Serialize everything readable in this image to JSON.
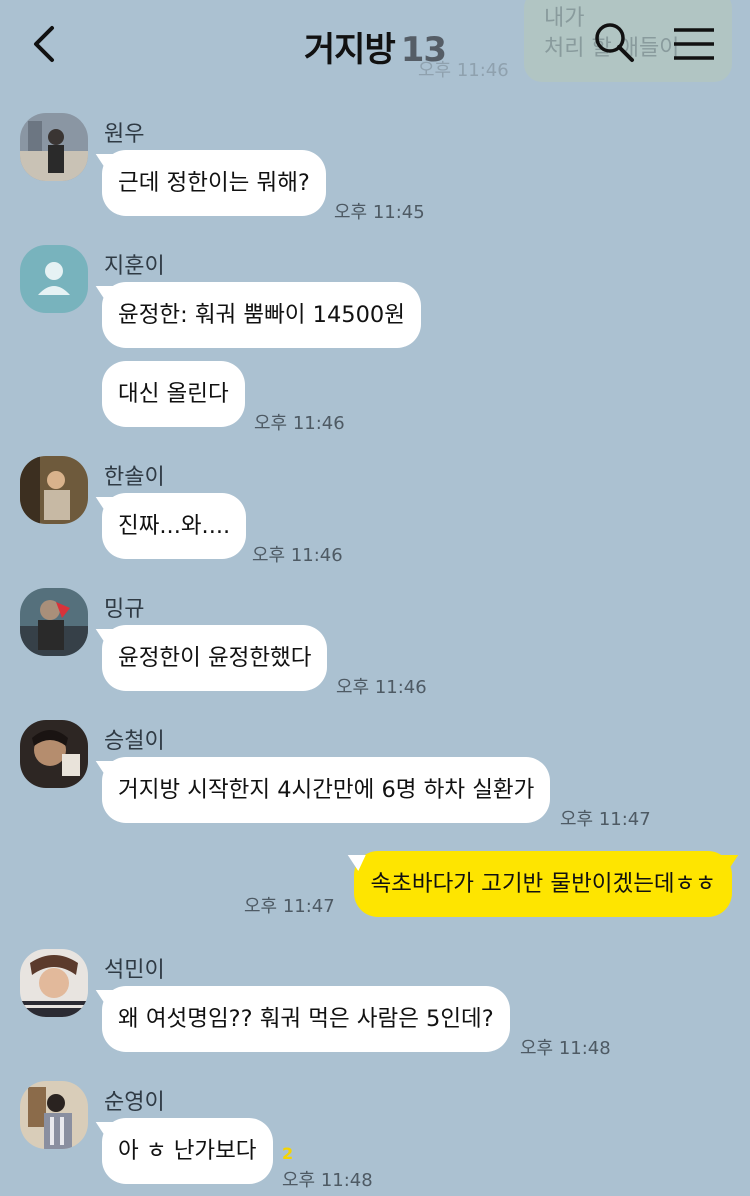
{
  "header": {
    "title": "거지방",
    "member_count": "13",
    "icons": [
      "chevron-left-icon",
      "search-icon",
      "hamburger-menu-icon"
    ]
  },
  "ghost_message": {
    "line1": "내가",
    "line2": "처리 할 애들이",
    "time": "오후 11:46"
  },
  "messages": [
    {
      "sender": "원우",
      "text": "근데 정한이는 뭐해?",
      "time": "오후 11:45"
    },
    {
      "sender": "지훈이",
      "text": "윤정한: 훠궈 뿜빠이 14500원"
    },
    {
      "text": "대신 올린다",
      "time": "오후 11:46"
    },
    {
      "sender": "한솔이",
      "text": "진짜...와....",
      "time": "오후 11:46"
    },
    {
      "sender": "밍규",
      "text": "윤정한이 윤정한했다",
      "time": "오후 11:46"
    },
    {
      "sender": "승철이",
      "text": "거지방 시작한지 4시간만에 6명 하차 실환가",
      "time": "오후 11:47"
    },
    {
      "sender": "me",
      "text": "속초바다가 고기반 물반이겠는데ㅎㅎ",
      "time": "오후 11:47"
    },
    {
      "sender": "석민이",
      "text": "왜 여섯명임?? 훠궈 먹은 사람은 5인데?",
      "time": "오후 11:48"
    },
    {
      "sender": "순영이",
      "text": "아 ㅎ 난가보다",
      "time": "오후 11:48",
      "unread": "2"
    }
  ],
  "colors": {
    "background": "#abc1d1",
    "my_bubble": "#fee500",
    "other_bubble": "#ffffff",
    "unread": "#f5d400"
  }
}
